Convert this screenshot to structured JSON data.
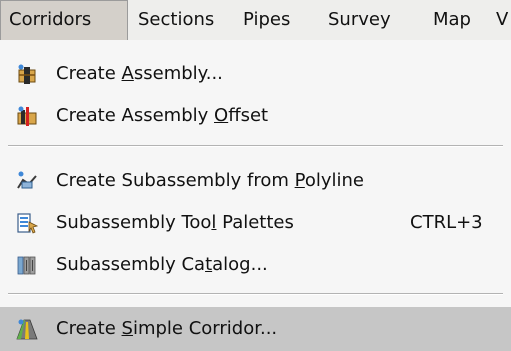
{
  "menubar": {
    "items": [
      {
        "label": "Corridors",
        "active": true
      },
      {
        "label": "Sections"
      },
      {
        "label": "Pipes"
      },
      {
        "label": "Survey"
      },
      {
        "label": "Map"
      },
      {
        "label": "V"
      }
    ]
  },
  "dropdown": {
    "items": [
      {
        "icon": "create-assembly-icon",
        "pre": "Create ",
        "mnemonic": "A",
        "post": "ssembly...",
        "shortcut": ""
      },
      {
        "icon": "create-assembly-offset-icon",
        "pre": "Create Assembly ",
        "mnemonic": "O",
        "post": "ffset",
        "shortcut": ""
      },
      {
        "icon": "create-subassembly-from-polyline-icon",
        "pre": "Create Subassembly from ",
        "mnemonic": "P",
        "post": "olyline",
        "shortcut": ""
      },
      {
        "icon": "subassembly-tool-palettes-icon",
        "pre": "Subassembly Too",
        "mnemonic": "l",
        "post": " Palettes",
        "shortcut": "CTRL+3"
      },
      {
        "icon": "subassembly-catalog-icon",
        "pre": "Subassembly Ca",
        "mnemonic": "t",
        "post": "alog...",
        "shortcut": ""
      },
      {
        "icon": "create-simple-corridor-icon",
        "pre": "Create ",
        "mnemonic": "S",
        "post": "imple Corridor...",
        "shortcut": "",
        "selected": true
      }
    ]
  }
}
